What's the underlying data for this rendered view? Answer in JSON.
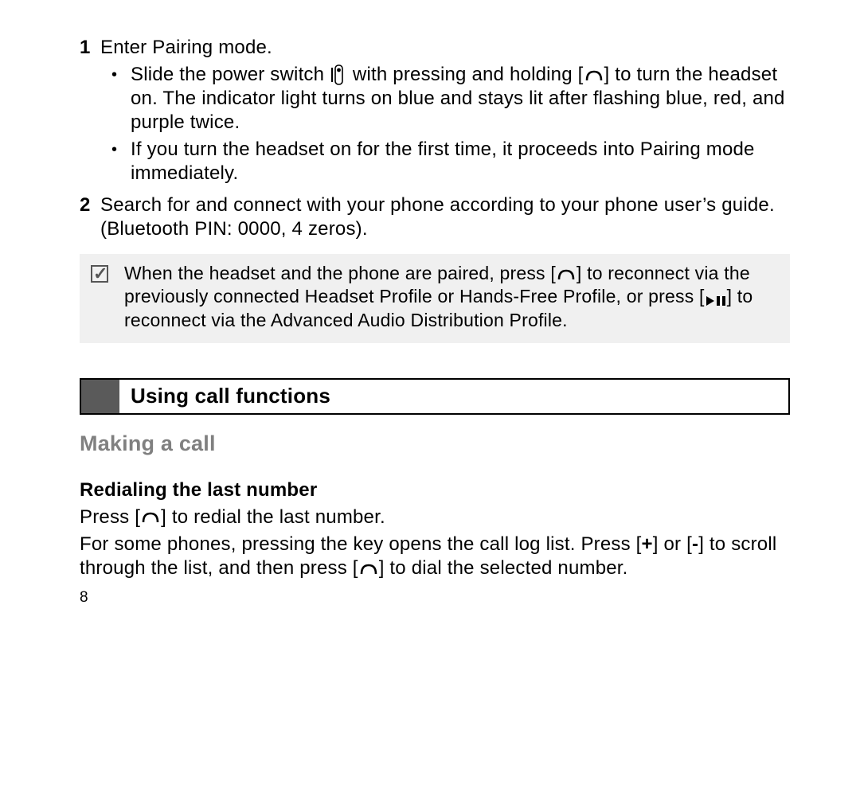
{
  "steps": [
    {
      "num": "1",
      "text": "Enter Pairing mode.",
      "bullets": [
        {
          "pre": "Slide the power switch ",
          "mid": " with pressing and holding [",
          "post": "] to turn the headset on. The indicator light turns on blue and stays lit after flashing blue, red, and purple twice."
        },
        {
          "text": "If you turn the headset on for the first time, it proceeds into Pairing mode immediately."
        }
      ]
    },
    {
      "num": "2",
      "text": "Search for and connect with your phone according to your phone user’s guide. (Bluetooth PIN: 0000, 4 zeros)."
    }
  ],
  "note": {
    "p1a": "When the headset and the phone are paired, press [",
    "p1b": "] to reconnect via the previously connected Headset Profile or Hands-Free Profile, or press [",
    "p1c": "] to reconnect via the Advanced Audio Distribution Profile."
  },
  "section_heading": "Using call functions",
  "subhead": "Making a call",
  "subsub": "Redialing the last number",
  "redial": {
    "a": "Press [",
    "b": "] to redial the last number."
  },
  "redial2": {
    "a": "For some phones, pressing the key opens the call log list. Press [",
    "plus": "+",
    "b": "] or [",
    "minus": "-",
    "c": "] to scroll through the list, and then press [",
    "d": "] to dial the selected number."
  },
  "page_number": "8"
}
